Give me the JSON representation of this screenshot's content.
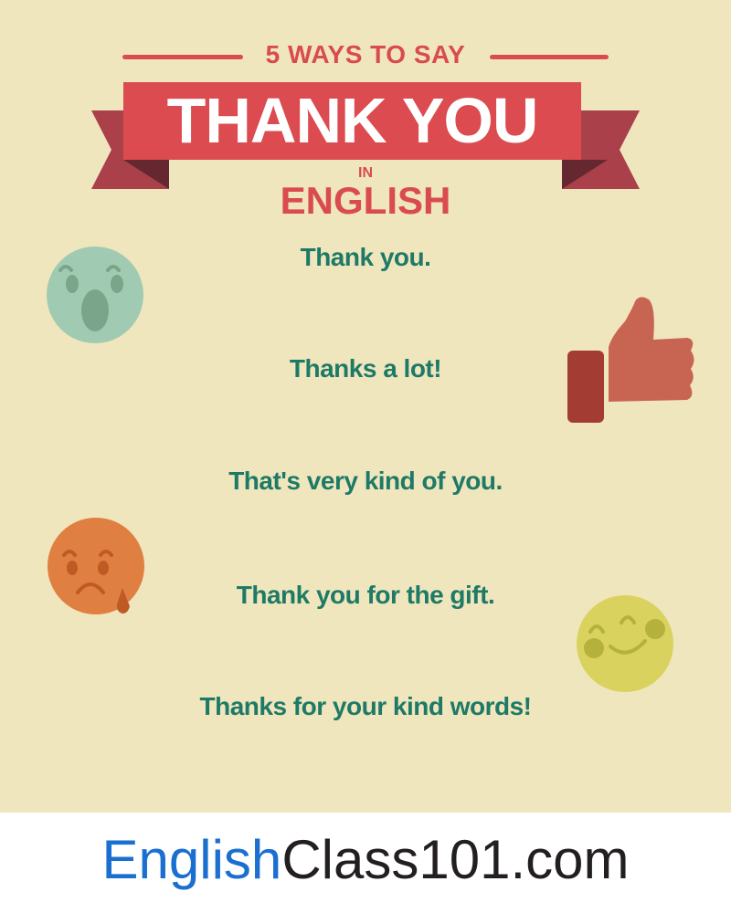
{
  "header": {
    "subtitle": "5 WAYS TO SAY",
    "title": "THANK YOU",
    "connector": "IN",
    "language": "ENGLISH"
  },
  "phrases": [
    "Thank you.",
    "Thanks a lot!",
    "That's very kind of you.",
    "Thank you for the gift.",
    "Thanks for your kind words!"
  ],
  "decorations": [
    "surprised-face-icon",
    "thumbs-up-icon",
    "sad-crying-face-icon",
    "happy-blushing-face-icon"
  ],
  "footer": {
    "brand_part1": "English",
    "brand_part2": "Class101.com"
  },
  "colors": {
    "background": "#f0e6bd",
    "banner_red": "#db4b50",
    "phrase_green": "#1e7a66",
    "brand_blue": "#1a6fd0"
  }
}
